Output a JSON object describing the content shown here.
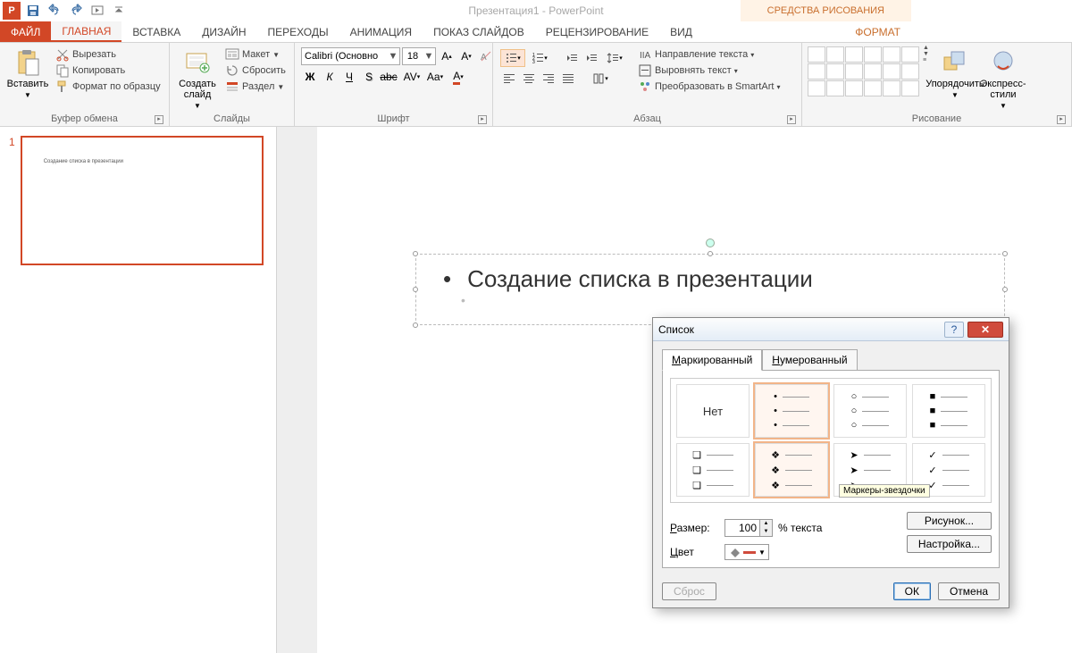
{
  "app": {
    "title": "Презентация1 - PowerPoint",
    "context_tab": "СРЕДСТВА РИСОВАНИЯ"
  },
  "tabs": {
    "file": "ФАЙЛ",
    "home": "ГЛАВНАЯ",
    "insert": "ВСТАВКА",
    "design": "ДИЗАЙН",
    "transitions": "ПЕРЕХОДЫ",
    "animations": "АНИМАЦИЯ",
    "slideshow": "ПОКАЗ СЛАЙДОВ",
    "review": "РЕЦЕНЗИРОВАНИЕ",
    "view": "ВИД",
    "format": "ФОРМАТ"
  },
  "ribbon": {
    "clipboard": {
      "label": "Буфер обмена",
      "paste": "Вставить",
      "cut": "Вырезать",
      "copy": "Копировать",
      "format_painter": "Формат по образцу"
    },
    "slides": {
      "label": "Слайды",
      "new_slide": "Создать слайд",
      "layout": "Макет",
      "reset": "Сбросить",
      "section": "Раздел"
    },
    "font": {
      "label": "Шрифт",
      "name": "Calibri (Основно",
      "size": "18"
    },
    "paragraph": {
      "label": "Абзац",
      "text_dir": "Направление текста",
      "align_text": "Выровнять текст",
      "smartart": "Преобразовать в SmartArt"
    },
    "drawing": {
      "label": "Рисование",
      "arrange": "Упорядочить",
      "quick_styles": "Экспресс-стили"
    }
  },
  "slide": {
    "number": "1",
    "thumb_text": "Создание списка в презентации",
    "bullet_text": "Создание списка в презентации"
  },
  "dialog": {
    "title": "Список",
    "tab_bulleted": "Маркированный",
    "tab_bulleted_u": "М",
    "tab_numbered": "Нумерованный",
    "tab_numbered_u": "Н",
    "none": "Нет",
    "tooltip": "Маркеры-звездочки",
    "size_label": "Размер:",
    "size_value": "100",
    "size_suffix": "% текста",
    "color_label": "Цвет",
    "picture_btn": "Рисунок...",
    "customize_btn": "Настройка...",
    "reset_btn": "Сброс",
    "ok_btn": "ОК",
    "cancel_btn": "Отмена"
  }
}
